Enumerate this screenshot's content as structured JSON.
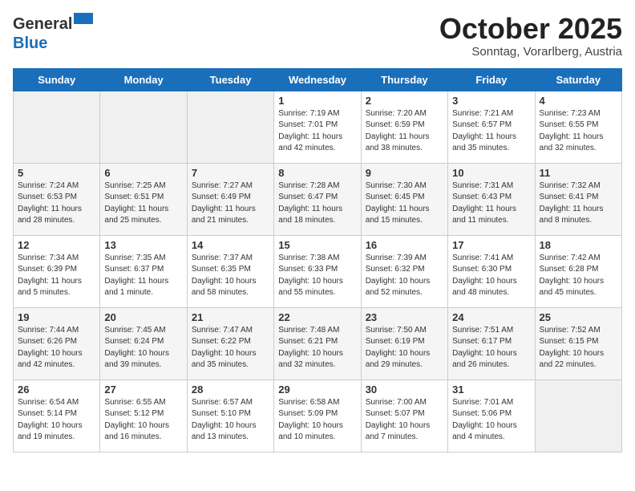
{
  "header": {
    "logo_line1": "General",
    "logo_line2": "Blue",
    "month": "October 2025",
    "location": "Sonntag, Vorarlberg, Austria"
  },
  "days_of_week": [
    "Sunday",
    "Monday",
    "Tuesday",
    "Wednesday",
    "Thursday",
    "Friday",
    "Saturday"
  ],
  "weeks": [
    [
      {
        "day": "",
        "content": ""
      },
      {
        "day": "",
        "content": ""
      },
      {
        "day": "",
        "content": ""
      },
      {
        "day": "1",
        "content": "Sunrise: 7:19 AM\nSunset: 7:01 PM\nDaylight: 11 hours\nand 42 minutes."
      },
      {
        "day": "2",
        "content": "Sunrise: 7:20 AM\nSunset: 6:59 PM\nDaylight: 11 hours\nand 38 minutes."
      },
      {
        "day": "3",
        "content": "Sunrise: 7:21 AM\nSunset: 6:57 PM\nDaylight: 11 hours\nand 35 minutes."
      },
      {
        "day": "4",
        "content": "Sunrise: 7:23 AM\nSunset: 6:55 PM\nDaylight: 11 hours\nand 32 minutes."
      }
    ],
    [
      {
        "day": "5",
        "content": "Sunrise: 7:24 AM\nSunset: 6:53 PM\nDaylight: 11 hours\nand 28 minutes."
      },
      {
        "day": "6",
        "content": "Sunrise: 7:25 AM\nSunset: 6:51 PM\nDaylight: 11 hours\nand 25 minutes."
      },
      {
        "day": "7",
        "content": "Sunrise: 7:27 AM\nSunset: 6:49 PM\nDaylight: 11 hours\nand 21 minutes."
      },
      {
        "day": "8",
        "content": "Sunrise: 7:28 AM\nSunset: 6:47 PM\nDaylight: 11 hours\nand 18 minutes."
      },
      {
        "day": "9",
        "content": "Sunrise: 7:30 AM\nSunset: 6:45 PM\nDaylight: 11 hours\nand 15 minutes."
      },
      {
        "day": "10",
        "content": "Sunrise: 7:31 AM\nSunset: 6:43 PM\nDaylight: 11 hours\nand 11 minutes."
      },
      {
        "day": "11",
        "content": "Sunrise: 7:32 AM\nSunset: 6:41 PM\nDaylight: 11 hours\nand 8 minutes."
      }
    ],
    [
      {
        "day": "12",
        "content": "Sunrise: 7:34 AM\nSunset: 6:39 PM\nDaylight: 11 hours\nand 5 minutes."
      },
      {
        "day": "13",
        "content": "Sunrise: 7:35 AM\nSunset: 6:37 PM\nDaylight: 11 hours\nand 1 minute."
      },
      {
        "day": "14",
        "content": "Sunrise: 7:37 AM\nSunset: 6:35 PM\nDaylight: 10 hours\nand 58 minutes."
      },
      {
        "day": "15",
        "content": "Sunrise: 7:38 AM\nSunset: 6:33 PM\nDaylight: 10 hours\nand 55 minutes."
      },
      {
        "day": "16",
        "content": "Sunrise: 7:39 AM\nSunset: 6:32 PM\nDaylight: 10 hours\nand 52 minutes."
      },
      {
        "day": "17",
        "content": "Sunrise: 7:41 AM\nSunset: 6:30 PM\nDaylight: 10 hours\nand 48 minutes."
      },
      {
        "day": "18",
        "content": "Sunrise: 7:42 AM\nSunset: 6:28 PM\nDaylight: 10 hours\nand 45 minutes."
      }
    ],
    [
      {
        "day": "19",
        "content": "Sunrise: 7:44 AM\nSunset: 6:26 PM\nDaylight: 10 hours\nand 42 minutes."
      },
      {
        "day": "20",
        "content": "Sunrise: 7:45 AM\nSunset: 6:24 PM\nDaylight: 10 hours\nand 39 minutes."
      },
      {
        "day": "21",
        "content": "Sunrise: 7:47 AM\nSunset: 6:22 PM\nDaylight: 10 hours\nand 35 minutes."
      },
      {
        "day": "22",
        "content": "Sunrise: 7:48 AM\nSunset: 6:21 PM\nDaylight: 10 hours\nand 32 minutes."
      },
      {
        "day": "23",
        "content": "Sunrise: 7:50 AM\nSunset: 6:19 PM\nDaylight: 10 hours\nand 29 minutes."
      },
      {
        "day": "24",
        "content": "Sunrise: 7:51 AM\nSunset: 6:17 PM\nDaylight: 10 hours\nand 26 minutes."
      },
      {
        "day": "25",
        "content": "Sunrise: 7:52 AM\nSunset: 6:15 PM\nDaylight: 10 hours\nand 22 minutes."
      }
    ],
    [
      {
        "day": "26",
        "content": "Sunrise: 6:54 AM\nSunset: 5:14 PM\nDaylight: 10 hours\nand 19 minutes."
      },
      {
        "day": "27",
        "content": "Sunrise: 6:55 AM\nSunset: 5:12 PM\nDaylight: 10 hours\nand 16 minutes."
      },
      {
        "day": "28",
        "content": "Sunrise: 6:57 AM\nSunset: 5:10 PM\nDaylight: 10 hours\nand 13 minutes."
      },
      {
        "day": "29",
        "content": "Sunrise: 6:58 AM\nSunset: 5:09 PM\nDaylight: 10 hours\nand 10 minutes."
      },
      {
        "day": "30",
        "content": "Sunrise: 7:00 AM\nSunset: 5:07 PM\nDaylight: 10 hours\nand 7 minutes."
      },
      {
        "day": "31",
        "content": "Sunrise: 7:01 AM\nSunset: 5:06 PM\nDaylight: 10 hours\nand 4 minutes."
      },
      {
        "day": "",
        "content": ""
      }
    ]
  ]
}
